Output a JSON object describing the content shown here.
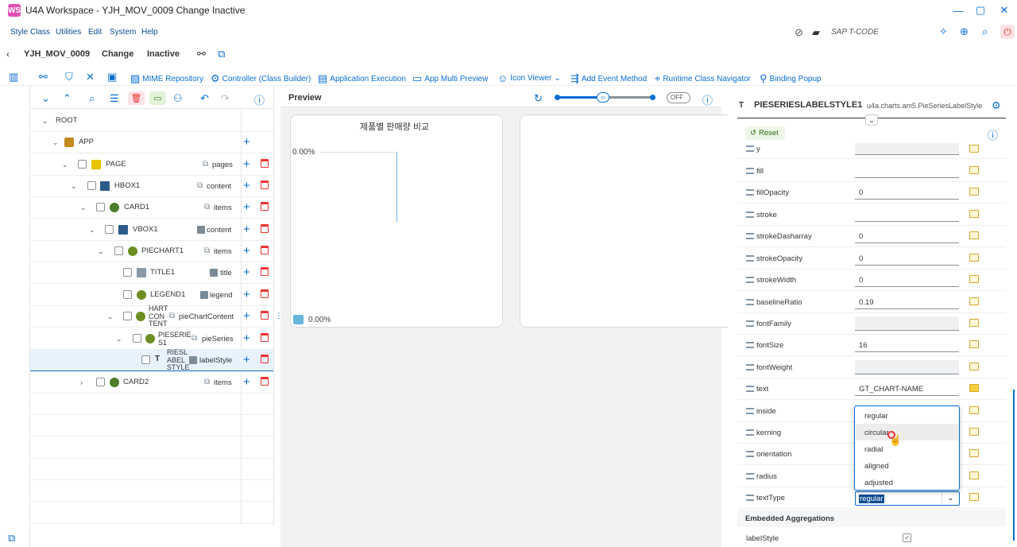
{
  "window": {
    "title": "U4A Workspace - YJH_MOV_0009 Change Inactive",
    "logo": "WS"
  },
  "menu": [
    "Style Class",
    "Utilities",
    "Edit",
    "System",
    "Help"
  ],
  "tcode_label": "SAP T-CODE",
  "page_header": {
    "app_id": "YJH_MOV_0009",
    "mode": "Change",
    "status": "Inactive"
  },
  "toolbar": [
    {
      "icon": "mime-icon",
      "label": "MIME Repository"
    },
    {
      "icon": "gear-icon",
      "label": "Controller (Class Builder)"
    },
    {
      "icon": "run-icon",
      "label": "Application Execution"
    },
    {
      "icon": "monitor-icon",
      "label": "App Multi Preview"
    },
    {
      "icon": "icon-viewer-icon",
      "label": "Icon Viewer"
    },
    {
      "icon": "event-icon",
      "label": "Add Event Method"
    },
    {
      "icon": "navigator-icon",
      "label": "Runtime Class Navigator"
    },
    {
      "icon": "binding-icon",
      "label": "Binding Popup"
    }
  ],
  "tree": [
    {
      "name": "ROOT",
      "agg": ""
    },
    {
      "name": "APP",
      "agg": ""
    },
    {
      "name": "PAGE",
      "agg": "pages"
    },
    {
      "name": "HBOX1",
      "agg": "content"
    },
    {
      "name": "CARD1",
      "agg": "items"
    },
    {
      "name": "VBOX1",
      "agg": "content"
    },
    {
      "name": "PIECHART1",
      "agg": "items"
    },
    {
      "name": "TITLE1",
      "agg": "title"
    },
    {
      "name": "LEGEND1",
      "agg": "legend"
    },
    {
      "name": "HART\nCON\nTENT",
      "agg": "pieChartContent"
    },
    {
      "name": "PIESERIE\nS1",
      "agg": "pieSeries"
    },
    {
      "name": "RIESL\nABEL\nSTYLE",
      "agg": "labelStyle"
    },
    {
      "name": "CARD2",
      "agg": "items"
    }
  ],
  "preview": {
    "title": "Preview",
    "toggle": "OFF",
    "chart_title": "제품별 판매량 비교",
    "axis_label": "0.00%",
    "legend_label": "0.00%"
  },
  "panel": {
    "node_name": "PIESERIESLABELSTYLE1",
    "class_name": "u4a.charts.am5.PieSeriesLabelStyle",
    "reset_label": "Reset",
    "properties": [
      {
        "name": "y",
        "value": "",
        "grey": true
      },
      {
        "name": "fill",
        "value": "",
        "grey": false
      },
      {
        "name": "fillOpacity",
        "value": "0",
        "grey": false
      },
      {
        "name": "stroke",
        "value": "",
        "grey": false
      },
      {
        "name": "strokeDasharray",
        "value": "0",
        "grey": false
      },
      {
        "name": "strokeOpacity",
        "value": "0",
        "grey": false
      },
      {
        "name": "strokeWidth",
        "value": "0",
        "grey": false
      },
      {
        "name": "baselineRatio",
        "value": "0.19",
        "grey": false
      },
      {
        "name": "fontFamily",
        "value": "",
        "grey": true
      },
      {
        "name": "fontSize",
        "value": "16",
        "grey": false
      },
      {
        "name": "fontWeight",
        "value": "",
        "grey": true
      },
      {
        "name": "text",
        "value": "GT_CHART-NAME",
        "grey": false
      },
      {
        "name": "inside",
        "value": "",
        "grey": false
      },
      {
        "name": "kerning",
        "value": "",
        "grey": false
      },
      {
        "name": "orientation",
        "value": "",
        "grey": false
      },
      {
        "name": "radius",
        "value": "",
        "grey": false
      },
      {
        "name": "textType",
        "value": "regular",
        "grey": false
      }
    ],
    "dropdown_options": [
      "regular",
      "circular",
      "radial",
      "aligned",
      "adjusted"
    ],
    "embedded_header": "Embedded Aggregations",
    "embedded_item": "labelStyle"
  }
}
